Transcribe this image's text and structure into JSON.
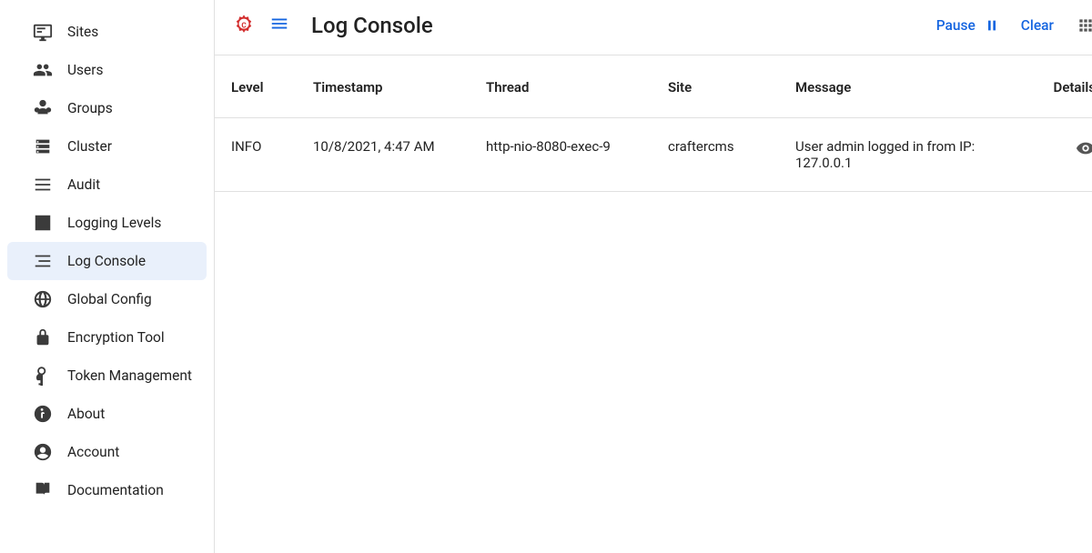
{
  "sidebar": {
    "items": [
      {
        "key": "sites",
        "label": "Sites"
      },
      {
        "key": "users",
        "label": "Users"
      },
      {
        "key": "groups",
        "label": "Groups"
      },
      {
        "key": "cluster",
        "label": "Cluster"
      },
      {
        "key": "audit",
        "label": "Audit"
      },
      {
        "key": "logging-levels",
        "label": "Logging Levels"
      },
      {
        "key": "log-console",
        "label": "Log Console"
      },
      {
        "key": "global-config",
        "label": "Global Config"
      },
      {
        "key": "encryption-tool",
        "label": "Encryption Tool"
      },
      {
        "key": "token-management",
        "label": "Token Management"
      },
      {
        "key": "about",
        "label": "About"
      },
      {
        "key": "account",
        "label": "Account"
      },
      {
        "key": "documentation",
        "label": "Documentation"
      }
    ],
    "active_index": 6
  },
  "header": {
    "title": "Log Console",
    "pause_label": "Pause",
    "clear_label": "Clear"
  },
  "table": {
    "columns": [
      "Level",
      "Timestamp",
      "Thread",
      "Site",
      "Message",
      "Details"
    ],
    "rows": [
      {
        "level": "INFO",
        "timestamp": "10/8/2021, 4:47 AM",
        "thread": "http-nio-8080-exec-9",
        "site": "craftercms",
        "message": "User admin logged in from IP: 127.0.0.1"
      }
    ]
  }
}
